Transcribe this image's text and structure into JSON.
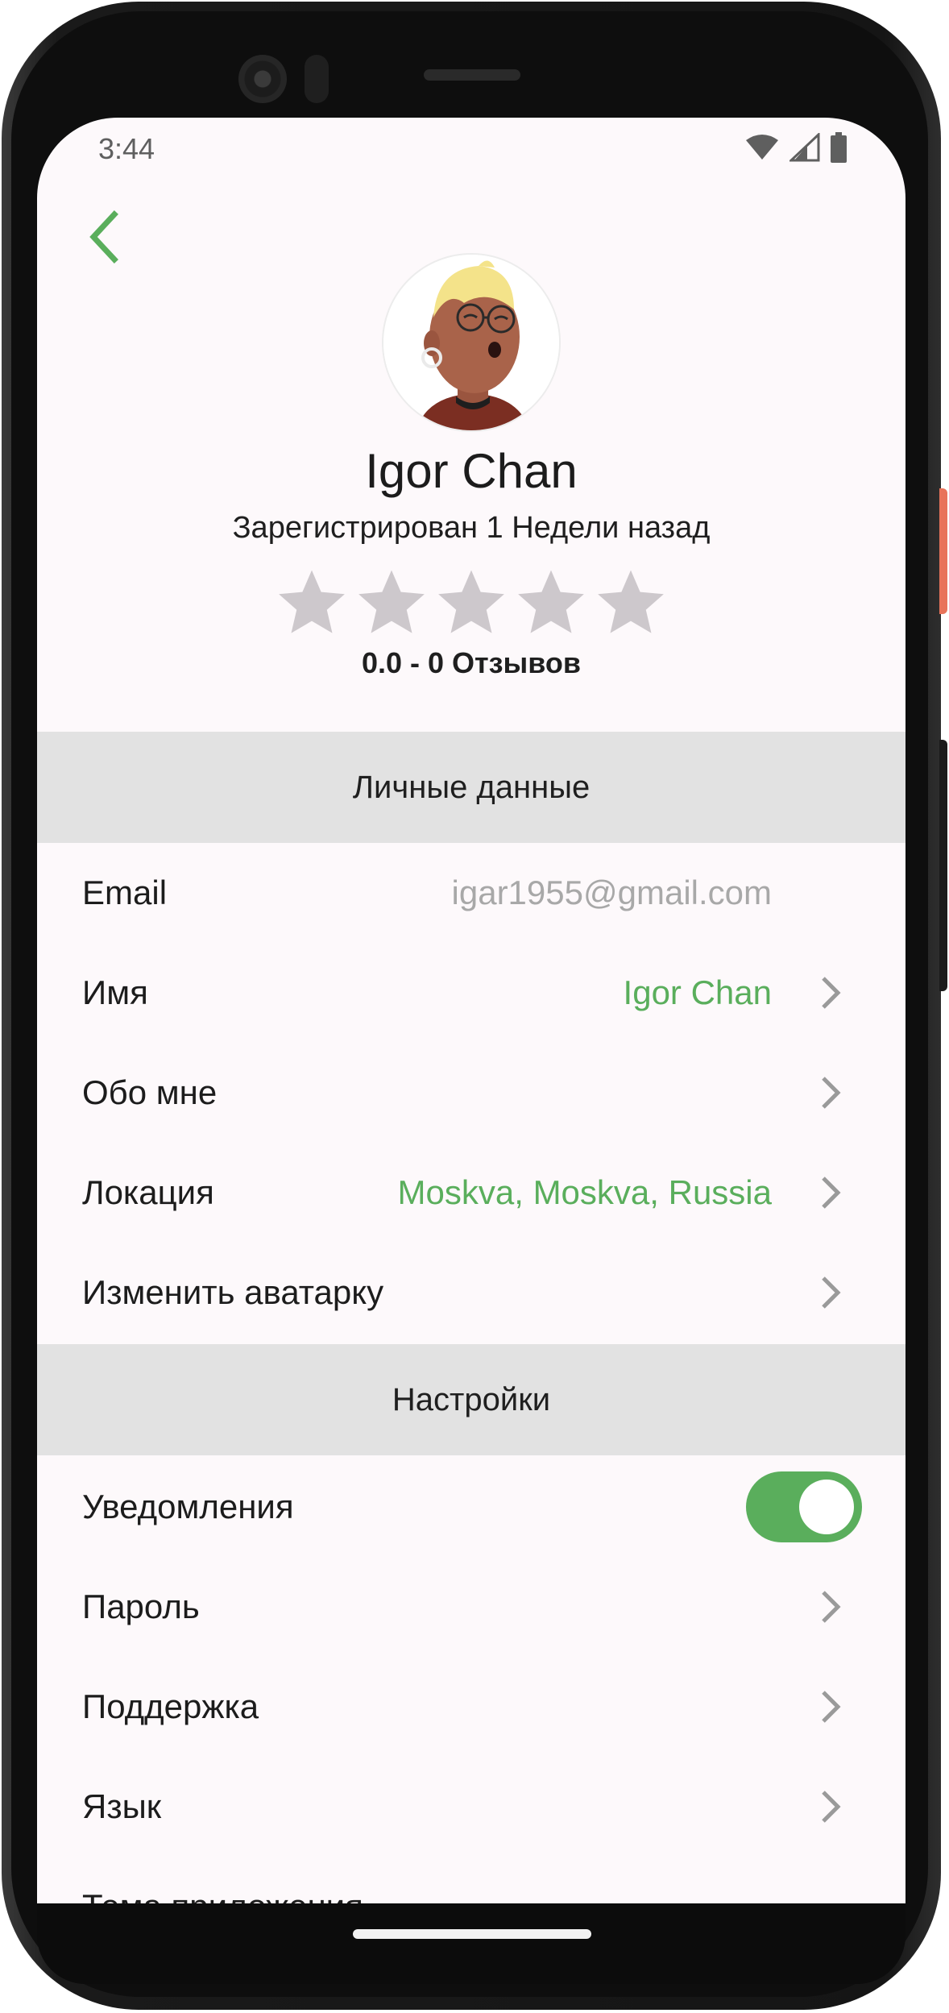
{
  "status_bar": {
    "time": "3:44"
  },
  "profile": {
    "name": "Igor Chan",
    "registered": "Зарегистрирован 1 Недели назад",
    "rating_text": "0.0 - 0 Отзывов",
    "rating_value": 0,
    "rating_max": 5
  },
  "personal": {
    "header": "Личные данные",
    "rows": [
      {
        "label": "Email",
        "value": "igar1955@gmail.com"
      },
      {
        "label": "Имя",
        "value": "Igor Chan"
      },
      {
        "label": "Обо мне",
        "value": ""
      },
      {
        "label": "Локация",
        "value": "Moskva, Moskva, Russia"
      },
      {
        "label": "Изменить аватарку",
        "value": ""
      }
    ]
  },
  "settings": {
    "header": "Настройки",
    "notifications": {
      "label": "Уведомления",
      "enabled": true
    },
    "rows": [
      {
        "label": "Пароль"
      },
      {
        "label": "Поддержка"
      },
      {
        "label": "Язык"
      },
      {
        "label": "Тема приложения"
      }
    ]
  },
  "colors": {
    "accent": "#5aae5c",
    "star_empty": "#cdc8cc",
    "section_bg": "#e2e2e2",
    "screen_bg": "#fdf9fb"
  },
  "icons": {
    "back": "chevron-left-icon",
    "row_arrow": "chevron-right-icon",
    "rating": "star-icon",
    "wifi": "wifi-icon",
    "signal": "signal-icon",
    "battery": "battery-icon"
  }
}
